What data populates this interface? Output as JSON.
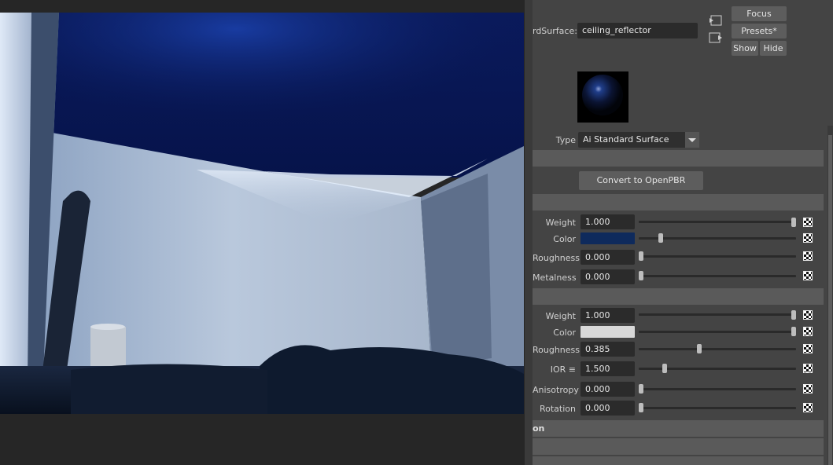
{
  "header": {
    "surface_label": "rdSurface:",
    "surface_value": "ceiling_reflector",
    "focus_label": "Focus",
    "presets_label": "Presets*",
    "show_label": "Show",
    "hide_label": "Hide"
  },
  "material": {
    "type_label": "Type",
    "type_value": "Ai Standard Surface",
    "convert_label": "Convert to OpenPBR Surface"
  },
  "base": {
    "weight": {
      "label": "Weight",
      "value": "1.000",
      "level": 1.0
    },
    "color": {
      "label": "Color",
      "hex": "#0e2a5c",
      "level": 0.13
    },
    "roughness": {
      "label": "Roughness",
      "value": "0.000",
      "level": 0.0
    },
    "metalness": {
      "label": "Metalness",
      "value": "0.000",
      "level": 0.0
    }
  },
  "specular": {
    "weight": {
      "label": "Weight",
      "value": "1.000",
      "level": 1.0
    },
    "color": {
      "label": "Color",
      "hex": "#d8d8d8",
      "level": 1.0
    },
    "roughness": {
      "label": "Roughness",
      "value": "0.385",
      "level": 0.385
    },
    "ior": {
      "label": "IOR ≡",
      "value": "1.500",
      "level": 0.15
    },
    "anisotropy": {
      "label": "Anisotropy",
      "value": "0.000",
      "level": 0.0
    },
    "rotation": {
      "label": "Rotation",
      "value": "0.000",
      "level": 0.0
    }
  },
  "sections": {
    "section_partial": "on"
  },
  "colors": {
    "panel_bg": "#444444",
    "field_bg": "#2b2b2b",
    "section_bg": "#5a5a5a",
    "ceiling_blue": "#0c1f6e"
  }
}
